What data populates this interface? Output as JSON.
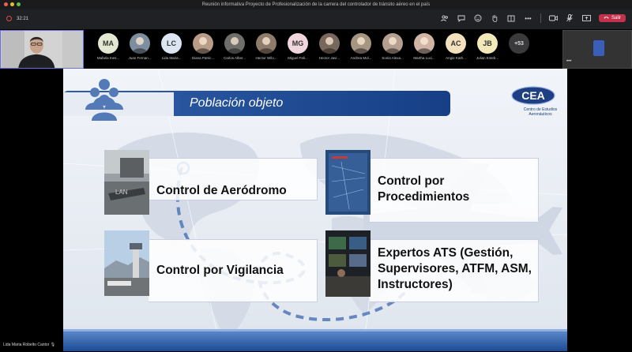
{
  "window": {
    "title": "Reunión informativa Proyecto de Profesionalización de la carrera del controlador de tránsito aéreo en el país"
  },
  "toolbar": {
    "timer": "32:21",
    "leave_label": "Salir",
    "leave_icon": "phone-hangup-icon"
  },
  "participants": [
    {
      "initials": "MA",
      "name": "Mabela Ines...",
      "color": "#e3e8d2"
    },
    {
      "initials": "",
      "name": "Juan Fernan...",
      "color": "#7d8f9f"
    },
    {
      "initials": "LC",
      "name": "Lida Maria...",
      "color": "#dce6f2"
    },
    {
      "initials": "",
      "name": "Diana Patric...",
      "color": "#b89c88"
    },
    {
      "initials": "",
      "name": "Carlos Alber...",
      "color": "#6f6e6a"
    },
    {
      "initials": "",
      "name": "Hector Wilo...",
      "color": "#8e7b6a"
    },
    {
      "initials": "MG",
      "name": "Miguel Feli...",
      "color": "#f1d7dd"
    },
    {
      "initials": "",
      "name": "Hector Javi...",
      "color": "#77675c"
    },
    {
      "initials": "",
      "name": "Andrea Mol...",
      "color": "#a59582"
    },
    {
      "initials": "",
      "name": "Sonia Alexa...",
      "color": "#b59f90"
    },
    {
      "initials": "",
      "name": "Martha Luci...",
      "color": "#d0b4a6"
    },
    {
      "initials": "AC",
      "name": "Angie Kath...",
      "color": "#f3e1bd"
    },
    {
      "initials": "JB",
      "name": "Julian Esteb...",
      "color": "#f2e8b8"
    },
    {
      "initials": "+53",
      "name": "",
      "color": "#3a3a3c"
    }
  ],
  "slide": {
    "title": "Población objeto",
    "logo_text": "CEA",
    "logo_subtitle": "Centro de Estudios Aeronáuticos",
    "cards": [
      {
        "label": "Control de Aeródromo"
      },
      {
        "label": "Control por Procedimientos"
      },
      {
        "label": "Control por Vigilancia"
      },
      {
        "label": "Expertos ATS (Gestión, Supervisores, ATFM, ASM, Instructores)"
      }
    ]
  },
  "footer": {
    "presenter": "Lida Maria Robelto Cantor"
  }
}
